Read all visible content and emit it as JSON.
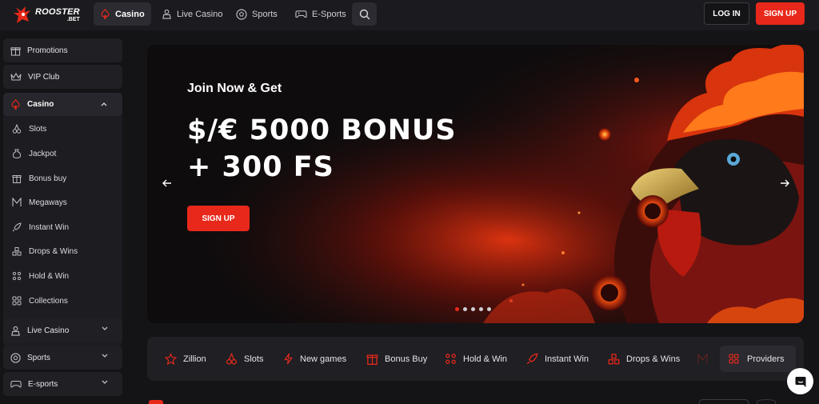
{
  "brand": {
    "name": "ROOSTER",
    "suffix": ".BET",
    "accent": "#e8281a"
  },
  "header": {
    "nav": [
      {
        "label": "Casino",
        "icon": "spade-icon",
        "active": true
      },
      {
        "label": "Live Casino",
        "icon": "dealer-icon"
      },
      {
        "label": "Sports",
        "icon": "soccer-ball-icon"
      },
      {
        "label": "E-Sports",
        "icon": "gamepad-icon"
      }
    ],
    "login_label": "LOG IN",
    "signup_label": "SIGN UP"
  },
  "sidebar": {
    "top_items": [
      {
        "label": "Promotions",
        "icon": "gift-icon"
      },
      {
        "label": "VIP Club",
        "icon": "crown-icon"
      }
    ],
    "casino": {
      "label": "Casino",
      "expanded": true,
      "items": [
        {
          "label": "Slots",
          "icon": "cherries-icon"
        },
        {
          "label": "Jackpot",
          "icon": "money-bag-icon"
        },
        {
          "label": "Bonus buy",
          "icon": "gift-box-icon"
        },
        {
          "label": "Megaways",
          "icon": "megaways-icon"
        },
        {
          "label": "Instant Win",
          "icon": "rocket-icon"
        },
        {
          "label": "Drops & Wins",
          "icon": "blocks-icon"
        },
        {
          "label": "Hold & Win",
          "icon": "grid-dots-icon"
        },
        {
          "label": "Collections",
          "icon": "collections-icon"
        }
      ]
    },
    "bottom_items": [
      {
        "label": "Live Casino",
        "icon": "dealer-icon"
      },
      {
        "label": "Sports",
        "icon": "soccer-ball-icon"
      },
      {
        "label": "E-sports",
        "icon": "gamepad-icon"
      }
    ]
  },
  "hero": {
    "kicker": "Join Now & Get",
    "headline_line1": "$/€ 5000 BONUS",
    "headline_line2": "+ 300 FS",
    "cta_label": "SIGN UP",
    "slides_total": 5,
    "active_slide": 1
  },
  "categories": [
    {
      "label": "Zillion",
      "icon": "star-icon"
    },
    {
      "label": "Slots",
      "icon": "cherries-icon"
    },
    {
      "label": "New games",
      "icon": "lightning-icon"
    },
    {
      "label": "Bonus Buy",
      "icon": "gift-box-icon"
    },
    {
      "label": "Hold & Win",
      "icon": "grid-dots-icon"
    },
    {
      "label": "Instant Win",
      "icon": "rocket-icon"
    },
    {
      "label": "Drops & Wins",
      "icon": "blocks-icon"
    }
  ],
  "providers_label": "Providers"
}
